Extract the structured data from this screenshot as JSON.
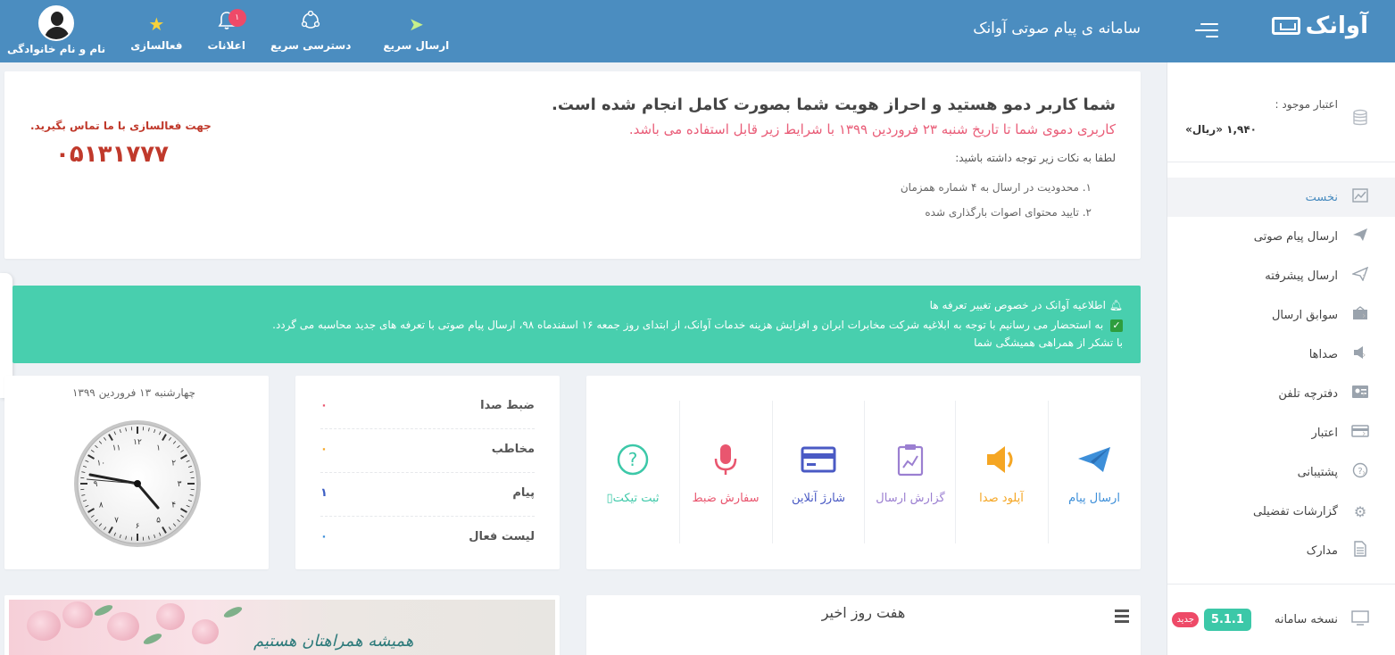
{
  "header": {
    "brand": "آوانک",
    "system_title": "سامانه ی پیام صوتی آوانک",
    "actions": [
      {
        "label": "ارسال سریع",
        "icon": "paper-plane-icon"
      },
      {
        "label": "دسترسی سریع",
        "icon": "network-icon"
      },
      {
        "label": "اعلانات",
        "icon": "bell-icon",
        "badge": "۱"
      },
      {
        "label": "فعالسازی",
        "icon": "star-icon"
      },
      {
        "label": "نام و نام خانوادگی",
        "icon": "avatar"
      }
    ]
  },
  "sidebar": {
    "credit_label": "اعتبار موجود :",
    "credit_value": "۱,۹۴۰ «ریال»",
    "items": [
      {
        "label": "نخست",
        "icon": "chart-icon",
        "active": true
      },
      {
        "label": "ارسال پیام صوتی",
        "icon": "send-icon"
      },
      {
        "label": "ارسال پیشرفته",
        "icon": "send-outline-icon"
      },
      {
        "label": "سوابق ارسال",
        "icon": "inbox-icon"
      },
      {
        "label": "صداها",
        "icon": "speaker-icon"
      },
      {
        "label": "دفترچه تلفن",
        "icon": "contact-card-icon"
      },
      {
        "label": "اعتبار",
        "icon": "credit-card-icon"
      },
      {
        "label": "پشتیبانی",
        "icon": "help-icon"
      },
      {
        "label": "گزارشات تفضیلی",
        "icon": "gear-icon"
      },
      {
        "label": "مدارک",
        "icon": "document-icon"
      }
    ],
    "version_label": "نسخه سامانه",
    "version_value": "5.1.1",
    "version_new": "جدید"
  },
  "notice": {
    "title": "شما کاربر دمو هستید و احراز هویت شما بصورت کامل انجام شده است.",
    "subtitle": "کاربری دموی شما تا تاریخ شنبه ۲۳ فروردین ۱۳۹۹ با شرایط زیر قابل استفاده می باشد.",
    "note_intro": "لطفا به نکات زیر توجه داشته باشید:",
    "notes": [
      "۱. محدودیت در ارسال به ۴ شماره همزمان",
      "۲. تایید محتوای اصوات بارگذاری شده"
    ],
    "contact_label": "جهت فعالسازی با ما تماس بگیرید.",
    "contact_phone": "۰۵۱۳۱۷۷۷"
  },
  "alert": {
    "title": "اطلاعیه آوانک در خصوص تغییر تعرفه ها",
    "body": "به استحضار می رسانیم با توجه به ابلاغیه شرکت مخابرات ایران و افزایش هزینه خدمات آوانک، از ابتدای روز جمعه ۱۶ اسفندماه ۹۸، ارسال پیام صوتی با تعرفه های جدید محاسبه می گردد.",
    "thanks": "با تشکر از همراهی همیشگی شما"
  },
  "quick_actions": [
    {
      "label": "ارسال پیام",
      "icon": "paper-plane-icon",
      "color": "#3d8fd9"
    },
    {
      "label": "آپلود صدا",
      "icon": "speaker-icon",
      "color": "#f5a623"
    },
    {
      "label": "گزارش ارسال",
      "icon": "clipboard-chart-icon",
      "color": "#9b7fd1"
    },
    {
      "label": "شارژ آنلاین",
      "icon": "credit-card-icon",
      "color": "#4a5ac4"
    },
    {
      "label": "سفارش ضبط",
      "icon": "microphone-icon",
      "color": "#e9566f"
    },
    {
      "label": "ثبت تیکت",
      "icon": "question-circle-icon",
      "color": "#3cc8a8",
      "suffix": "▯"
    }
  ],
  "stats": [
    {
      "label": "ضبط صدا",
      "value": "۰",
      "color": "#e9566f"
    },
    {
      "label": "مخاطب",
      "value": "۰",
      "color": "#f5a623"
    },
    {
      "label": "پیام",
      "value": "۱",
      "color": "#3d5fc4"
    },
    {
      "label": "لیست فعال",
      "value": "۰",
      "color": "#3d8fd9"
    }
  ],
  "clock": {
    "date": "چهارشنبه ۱۳ فروردین ۱۳۹۹",
    "numbers": [
      "۱۲",
      "۱",
      "۲",
      "۳",
      "۴",
      "۵",
      "۶",
      "۷",
      "۸",
      "۹",
      "۱۰",
      "۱۱"
    ]
  },
  "weekly_chart": {
    "title": "هفت روز اخیر"
  },
  "banner": {
    "text": "همیشه همراهتان هستیم"
  }
}
